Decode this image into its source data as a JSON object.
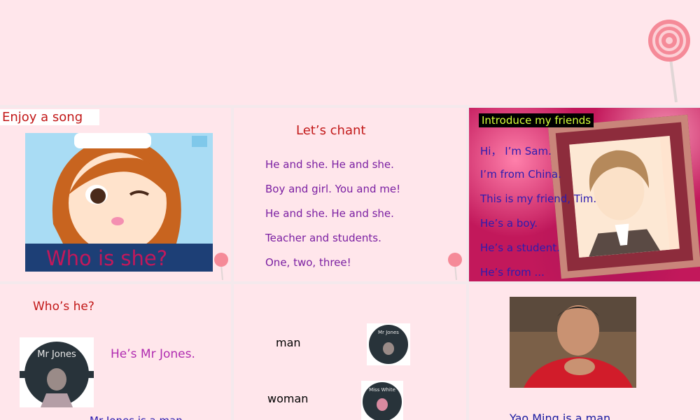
{
  "panel1": {
    "title": "Enjoy a song",
    "caption": "Who is she?"
  },
  "panel2": {
    "title": "Let’s chant",
    "lines": [
      "He and she. He and she.",
      "Boy and girl. You and me!",
      "He and she. He and she.",
      "Teacher and students.",
      "One,  two,  three!"
    ]
  },
  "panel3": {
    "title": "Introduce my friends",
    "lines": [
      "Hi，  I’m Sam.",
      "I’m from China.",
      "This is my friend, Tim.",
      "He’s a boy.",
      "He’s a student.",
      "He’s from ..."
    ]
  },
  "panel4": {
    "title": "Who’s he?",
    "badge": "Mr Jones",
    "answer": "He’s Mr Jones.",
    "cut_line": "Mr Jones is a man."
  },
  "panel5": {
    "word1": "man",
    "word2": "woman",
    "badge1": "Mr Jones",
    "badge2": "Miss White"
  },
  "panel6": {
    "caption": "Yao Ming is a man."
  },
  "colors": {
    "background": "#ffe6eb",
    "title_red": "#c21818",
    "purple": "#7b1fa2",
    "blue": "#2c1cb0"
  }
}
